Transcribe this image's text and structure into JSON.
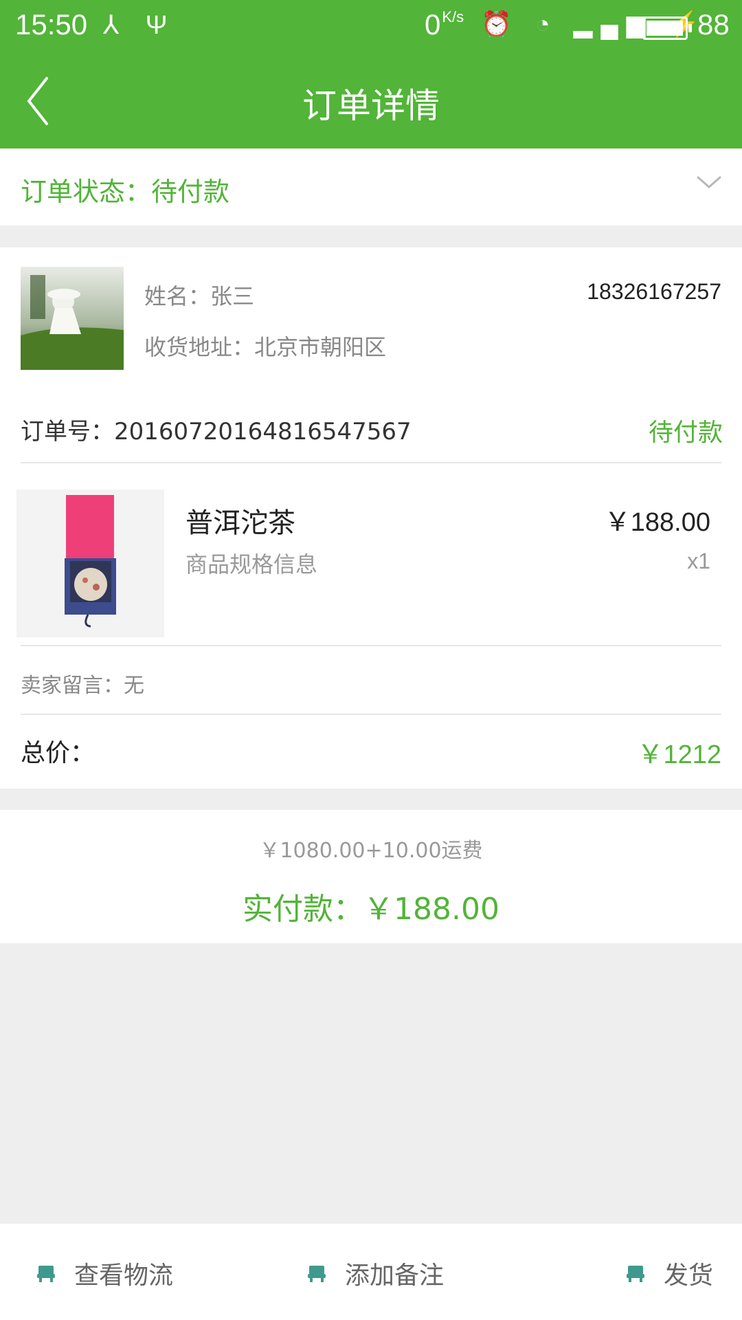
{
  "status_bar": {
    "time": "15:50",
    "network_speed": "0",
    "speed_unit": "K/s",
    "battery": "88"
  },
  "header": {
    "title": "订单详情"
  },
  "order_status": {
    "label": "订单状态：待付款"
  },
  "recipient": {
    "name": "姓名：张三",
    "phone": "18326167257",
    "address": "收货地址：北京市朝阳区"
  },
  "order": {
    "number": "订单号：20160720164816547567",
    "state": "待付款"
  },
  "product": {
    "name": "普洱沱茶",
    "spec": "商品规格信息",
    "price": "￥188.00",
    "quantity": "x1"
  },
  "seller_note": "卖家留言：无",
  "total": {
    "label": "总价：",
    "value": "￥1212"
  },
  "summary": {
    "breakdown": "￥1080.00+10.00运费",
    "paid": "实付款：￥188.00"
  },
  "actions": [
    {
      "label": "查看物流"
    },
    {
      "label": "添加备注"
    },
    {
      "label": "发货"
    }
  ],
  "colors": {
    "brand_green": "#52b438",
    "background": "#eeeeee",
    "text_muted": "#888888",
    "icon_teal": "#3f9a8d"
  }
}
